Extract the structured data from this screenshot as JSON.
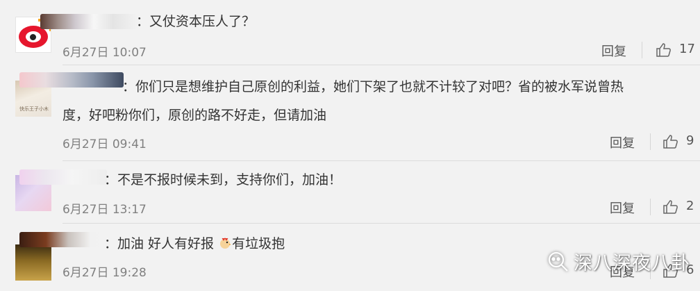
{
  "comments": [
    {
      "text": "：又仗资本压人了？",
      "time": "6月27日 10:07",
      "reply": "回复",
      "likes": "17"
    },
    {
      "text": "：你们只是想维护自己原创的利益，她们下架了也就不计较了对吧？省的被水军说曾热度，好吧粉你们，原创的路不好走，但请加油",
      "line1": "：你们只是想维护自己原创的利益，她们下架了也就不计较了对吧？省的被水军说曾热",
      "line2": "度，好吧粉你们，原创的路不好走，但请加油",
      "avatar_caption": "快乐王子小木",
      "time": "6月27日 09:41",
      "reply": "回复",
      "likes": "9"
    },
    {
      "text": "：不是不报时候未到，支持你们，加油！",
      "time": "6月27日 13:17",
      "reply": "回复",
      "likes": "2"
    },
    {
      "text_a": "：加油 好人有好报 ",
      "text_b": "有垃圾抱",
      "time": "6月27日 19:28",
      "reply": "回复",
      "likes": "6"
    }
  ],
  "watermark": {
    "text": "深八深夜八卦"
  },
  "colors": {
    "background": "#f2f2f2",
    "text": "#333333",
    "time": "#808080",
    "weibo_red": "#e6162d"
  },
  "icons": {
    "like": "thumbs-up-icon",
    "watermark": "wechat-search-icon",
    "emoji": "chicken-emoji"
  }
}
